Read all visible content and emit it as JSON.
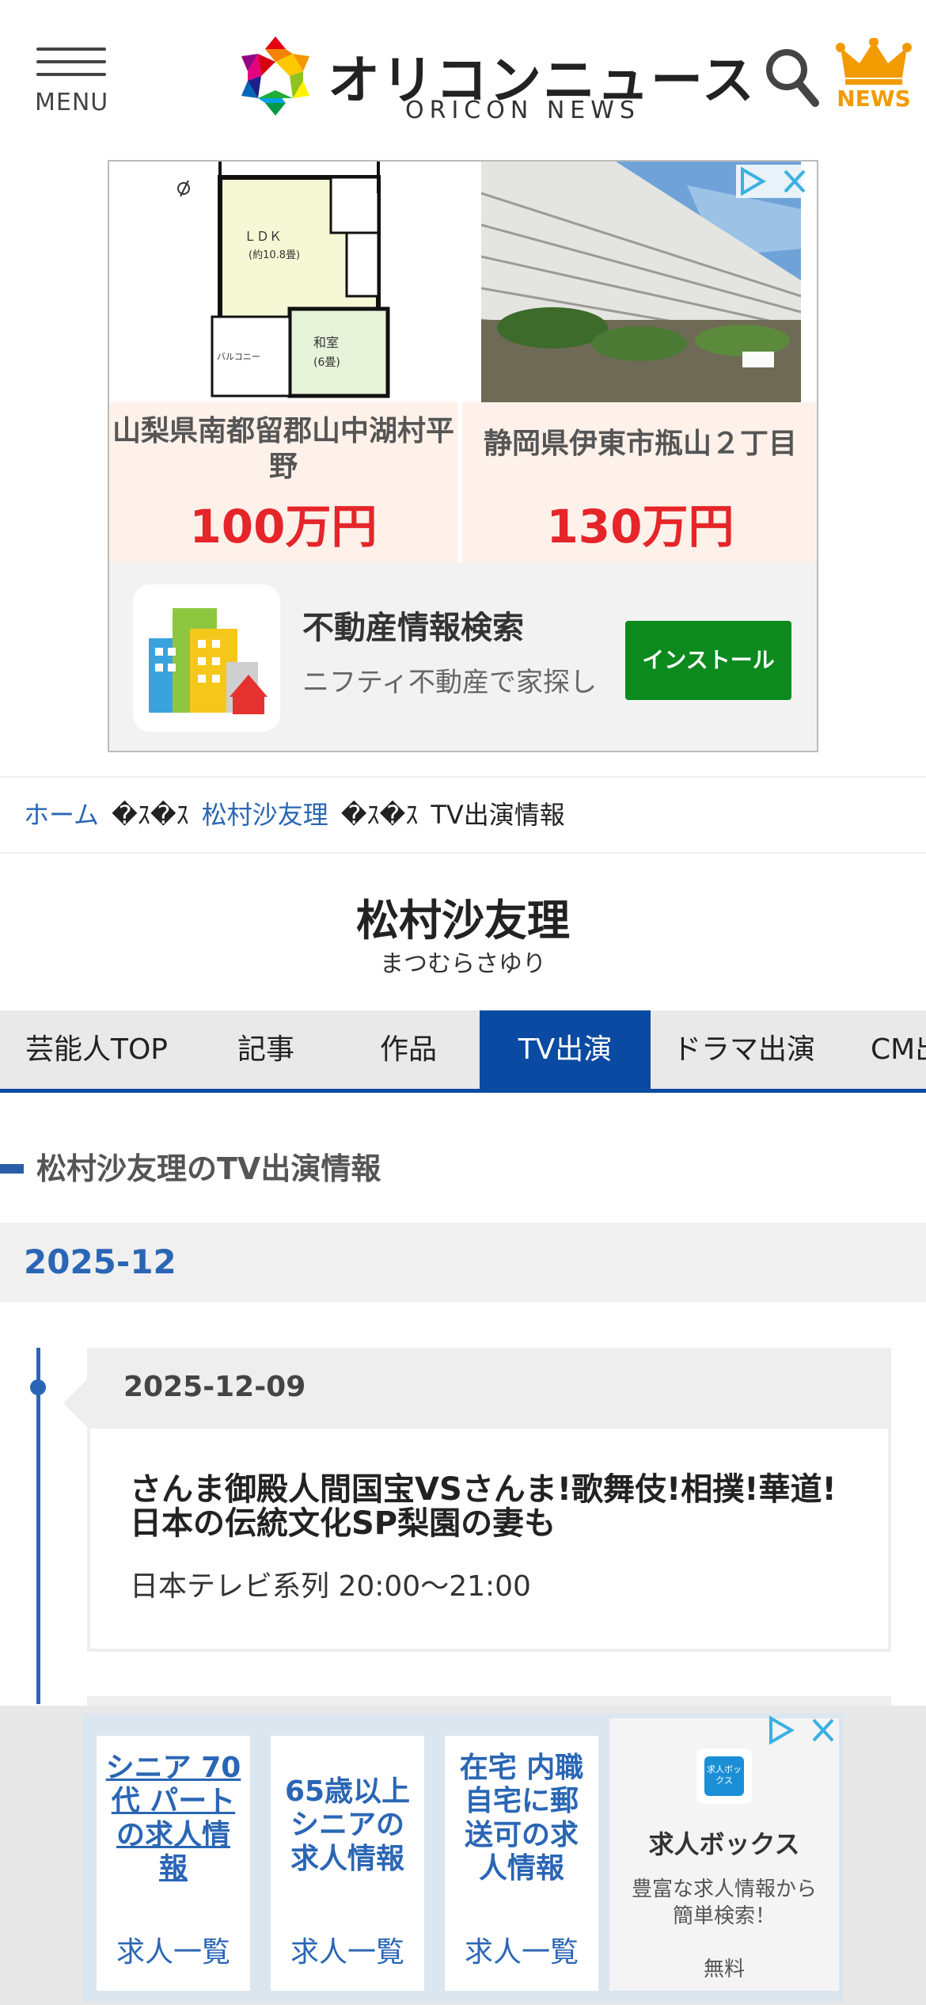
{
  "header": {
    "menu_label": "MENU",
    "logo_text_jp": "オリコンニュース",
    "logo_text_en": "ORICON NEWS",
    "news_label": "NEWS",
    "accent_color": "#f29b00"
  },
  "top_ad": {
    "property1": {
      "address": "山梨県南都留郡山中湖村平野",
      "price": "100万円"
    },
    "property2": {
      "address": "静岡県伊東市瓶山２丁目",
      "price": "130万円"
    },
    "floorplan": {
      "room1": "ＬＤＫ",
      "room1_size": "(約10.8畳)",
      "room2": "和室",
      "room2_size": "(6畳)",
      "balcony": "バルコニー"
    },
    "app_title": "不動産情報検索",
    "app_desc": "ニフティ不動産で家探し",
    "install_label": "インストール"
  },
  "breadcrumb": {
    "home": "ホーム",
    "sep1": "�ｽ�ｽ",
    "artist": "松村沙友理",
    "sep2": "�ｽ�ｽ",
    "current": "TV出演情報"
  },
  "page": {
    "title": "松村沙友理",
    "kana": "まつむらさゆり"
  },
  "tabs": [
    {
      "label": "芸能人TOP",
      "active": false
    },
    {
      "label": "記事",
      "active": false
    },
    {
      "label": "作品",
      "active": false
    },
    {
      "label": "TV出演",
      "active": true
    },
    {
      "label": "ドラマ出演",
      "active": false
    },
    {
      "label": "CM出演",
      "active": false
    }
  ],
  "section": {
    "heading": "松村沙友理のTV出演情報",
    "month": "2025-12"
  },
  "entries": [
    {
      "date": "2025-12-09",
      "title": "さんま御殿人間国宝VSさんま!歌舞伎!相撲!華道!日本の伝統文化SP梨園の妻も",
      "network_time": "日本テレビ系列 20:00〜21:00"
    }
  ],
  "bottom_ad": {
    "columns": [
      {
        "title": "シニア 70代 パートの求人情報",
        "link": "求人一覧"
      },
      {
        "title": "65歳以上シニアの求人情報",
        "link": "求人一覧"
      },
      {
        "title": "在宅 内職 自宅に郵送可の求人情報",
        "link": "求人一覧"
      }
    ],
    "brand_icon_text": "求人ボックス",
    "brand_name": "求人ボックス",
    "brand_desc": "豊富な求人情報から簡単検索！",
    "brand_price": "無料"
  }
}
